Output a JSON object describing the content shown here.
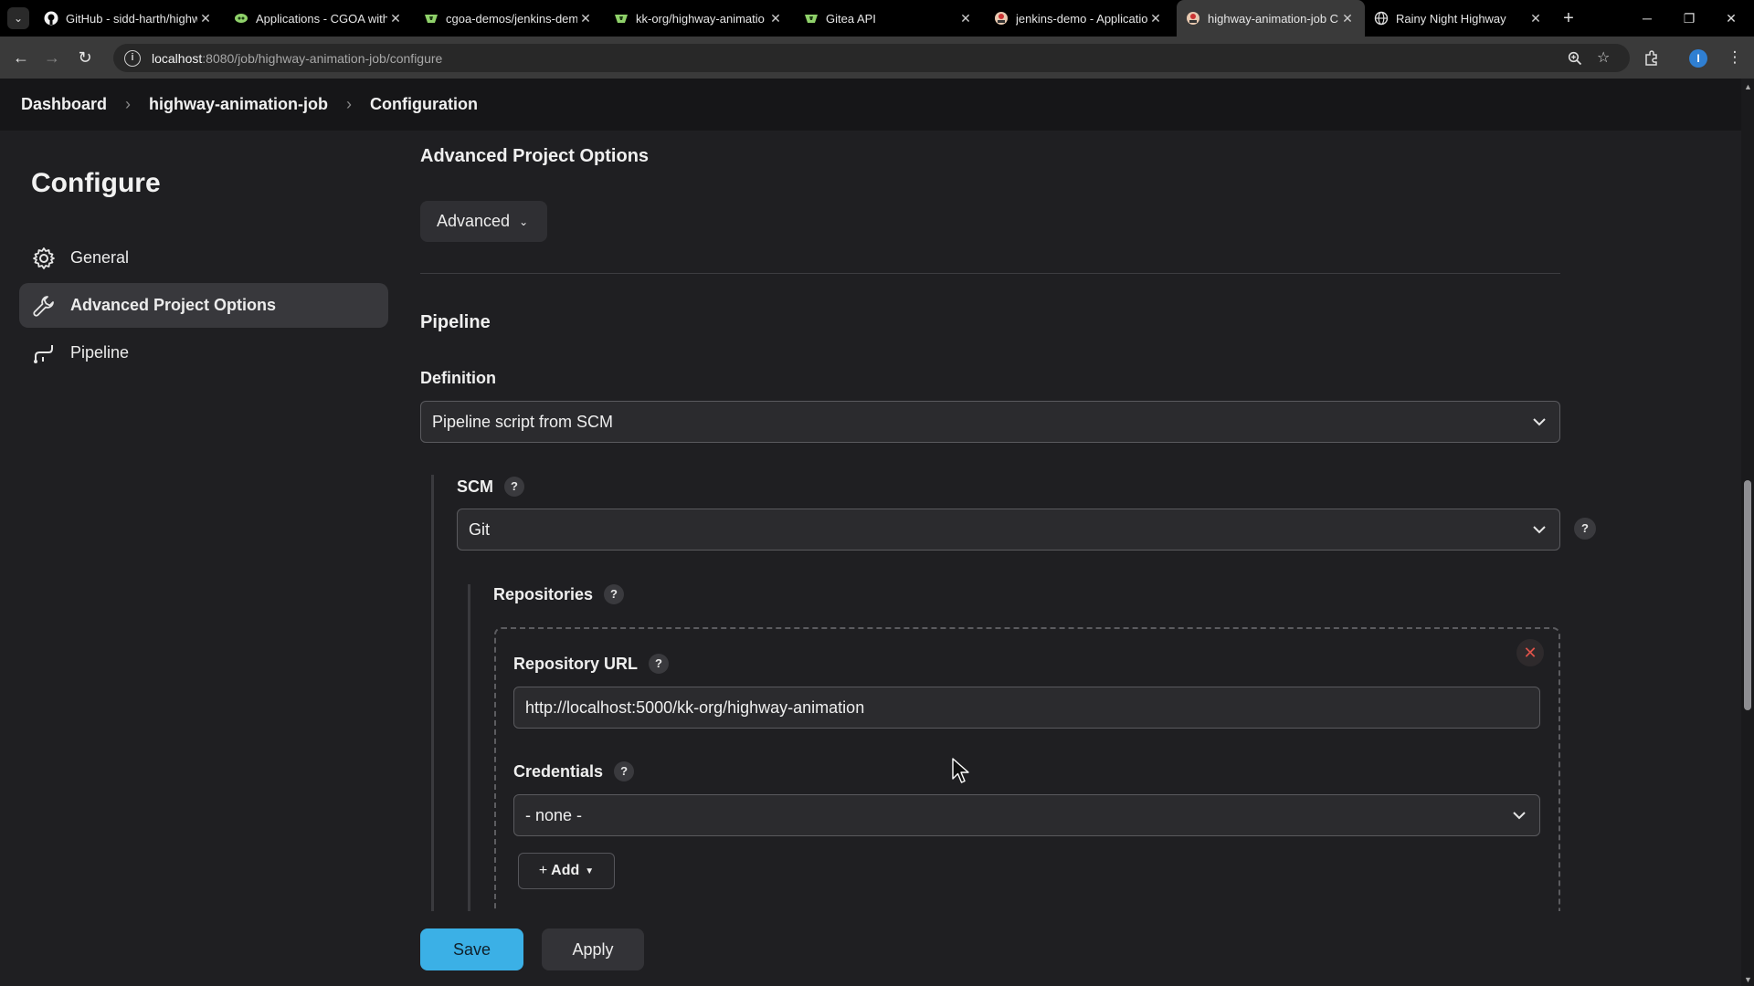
{
  "browser": {
    "tabs": [
      {
        "title": "GitHub - sidd-harth/highw",
        "icon": "github-icon"
      },
      {
        "title": "Applications - CGOA with",
        "icon": "argo-icon"
      },
      {
        "title": "cgoa-demos/jenkins-dem",
        "icon": "gitea-icon"
      },
      {
        "title": "kk-org/highway-animatio",
        "icon": "gitea-icon"
      },
      {
        "title": "Gitea API",
        "icon": "gitea-icon"
      },
      {
        "title": "jenkins-demo - Applicatio",
        "icon": "jenkins-icon"
      },
      {
        "title": "highway-animation-job C",
        "icon": "jenkins-icon",
        "active": true
      },
      {
        "title": "Rainy Night Highway",
        "icon": "globe-icon"
      }
    ],
    "url_host": "localhost",
    "url_rest": ":8080/job/highway-animation-job/configure",
    "profile_initial": "I"
  },
  "breadcrumb": {
    "items": [
      "Dashboard",
      "highway-animation-job",
      "Configuration"
    ]
  },
  "sidebar": {
    "title": "Configure",
    "items": [
      {
        "label": "General",
        "icon": "gear-icon"
      },
      {
        "label": "Advanced Project Options",
        "icon": "wrench-icon",
        "active": true
      },
      {
        "label": "Pipeline",
        "icon": "pipeline-icon"
      }
    ]
  },
  "main": {
    "advanced_section_title": "Advanced Project Options",
    "advanced_button": "Advanced",
    "pipeline_section_title": "Pipeline",
    "definition_label": "Definition",
    "definition_value": "Pipeline script from SCM",
    "scm_label": "SCM",
    "scm_value": "Git",
    "repositories_label": "Repositories",
    "repo_url_label": "Repository URL",
    "repo_url_value": "http://localhost:5000/kk-org/highway-animation",
    "credentials_label": "Credentials",
    "credentials_value": "- none -",
    "add_button": "Add",
    "help_glyph": "?"
  },
  "footer": {
    "save": "Save",
    "apply": "Apply"
  },
  "colors": {
    "accent": "#3bb0e6",
    "background": "#1f1f22",
    "danger": "#e0534a"
  }
}
